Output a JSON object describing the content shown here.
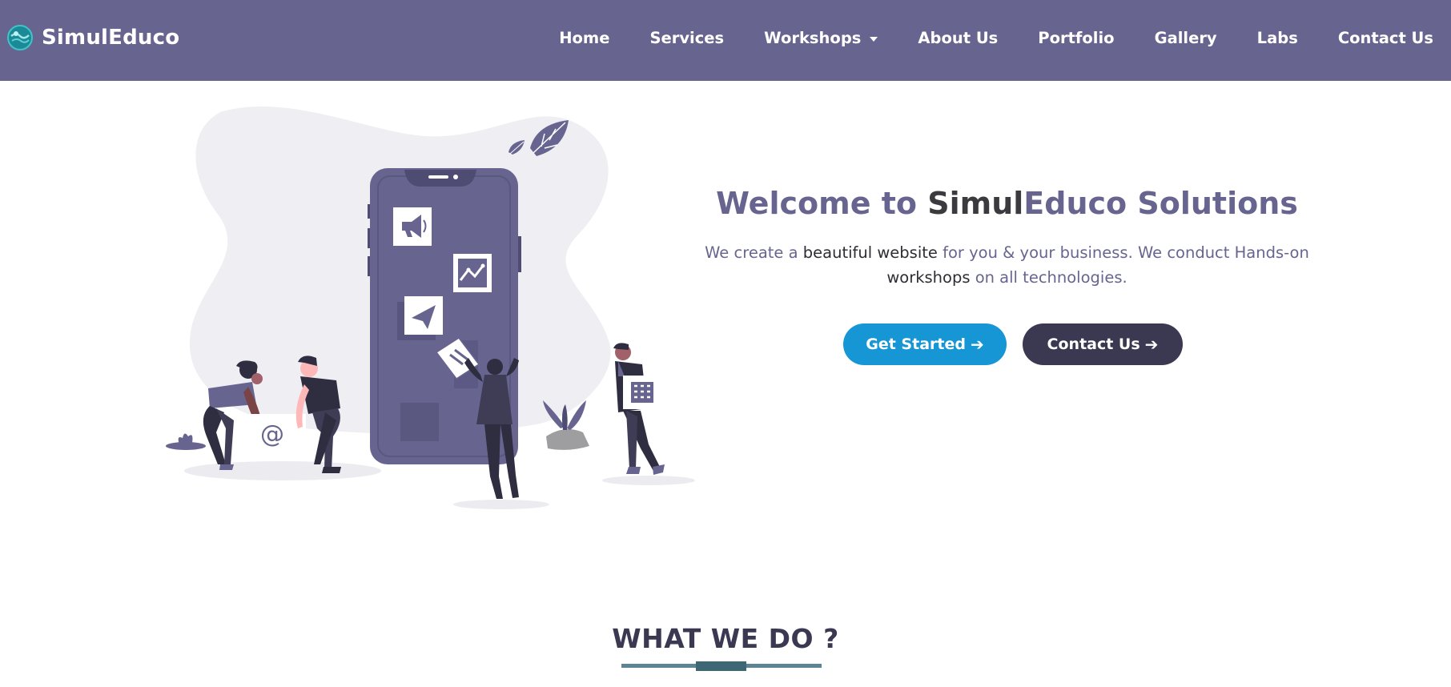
{
  "brand": {
    "name": "SimulEduco",
    "logo_icon": "globe-logo-icon"
  },
  "nav": {
    "items": [
      {
        "label": "Home"
      },
      {
        "label": "Services"
      },
      {
        "label": "Workshops",
        "has_dropdown": true
      },
      {
        "label": "About Us"
      },
      {
        "label": "Portfolio"
      },
      {
        "label": "Gallery"
      },
      {
        "label": "Labs"
      },
      {
        "label": "Contact Us"
      }
    ]
  },
  "hero": {
    "title_part1": "Welcome to ",
    "title_part2": "Simul",
    "title_part3": "Educo Solutions",
    "desc_1": "We create a ",
    "desc_2": "beautiful website",
    "desc_3": " for you & your business. We conduct Hands-on ",
    "desc_4": "workshops",
    "desc_5": " on all technologies.",
    "btn_primary": "Get Started",
    "btn_secondary": "Contact Us",
    "arrow_icon": "arrow-right-icon"
  },
  "section": {
    "title": "WHAT WE DO ?"
  },
  "illustration": {
    "email_symbol": "@"
  },
  "colors": {
    "navbar": "#67658f",
    "accent": "#1796d6",
    "dark_button": "#3b3852",
    "text_purple": "#67658f"
  }
}
